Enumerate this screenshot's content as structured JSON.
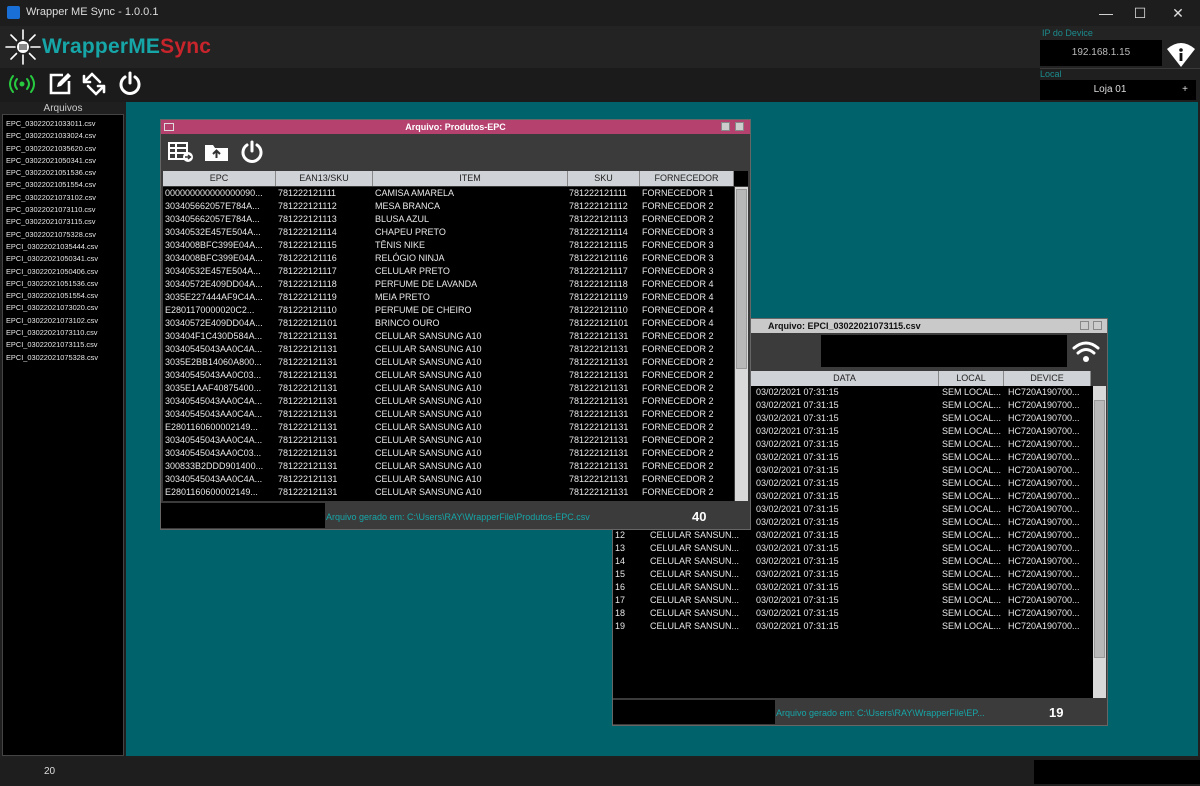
{
  "app": {
    "title": "Wrapper ME Sync - 1.0.0.1",
    "logo_wrapper": "WrapperME",
    "logo_sync": "Sync"
  },
  "window_controls": {
    "minimize": "—",
    "maximize": "☐",
    "close": "✕"
  },
  "toolbar": {
    "icons": [
      "rfid-signal-icon",
      "edit-icon",
      "sync-arrows-icon",
      "power-icon"
    ]
  },
  "device": {
    "ip_label": "IP do Device",
    "ip_value": "192.168.1.15",
    "local_label": "Local",
    "local_value": "Loja 01",
    "local_expand": "+"
  },
  "sidebar": {
    "title": "Arquivos",
    "files": [
      "EPC_03022021033011.csv",
      "EPC_03022021033024.csv",
      "EPC_03022021035620.csv",
      "EPC_03022021050341.csv",
      "EPC_03022021051536.csv",
      "EPC_03022021051554.csv",
      "EPC_03022021073102.csv",
      "EPC_03022021073110.csv",
      "EPC_03022021073115.csv",
      "EPC_03022021075328.csv",
      "EPCI_03022021035444.csv",
      "EPCI_03022021050341.csv",
      "EPCI_03022021050406.csv",
      "EPCI_03022021051536.csv",
      "EPCI_03022021051554.csv",
      "EPCI_03022021073020.csv",
      "EPCI_03022021073102.csv",
      "EPCI_03022021073110.csv",
      "EPCI_03022021073115.csv",
      "EPCI_03022021075328.csv"
    ]
  },
  "status": {
    "count": "20"
  },
  "products_window": {
    "title": "Arquivo: Produtos-EPC",
    "title_bg": "#b5416f",
    "columns": [
      "EPC",
      "EAN13/SKU",
      "ITEM",
      "SKU",
      "FORNECEDOR"
    ],
    "rows": [
      [
        "000000000000000090...",
        "781222121111",
        "CAMISA AMARELA",
        "781222121111",
        "FORNECEDOR 1"
      ],
      [
        "303405662057E784A...",
        "781222121112",
        "MESA BRANCA",
        "781222121112",
        "FORNECEDOR 2"
      ],
      [
        "303405662057E784A...",
        "781222121113",
        "BLUSA AZUL",
        "781222121113",
        "FORNECEDOR 2"
      ],
      [
        "30340532E457E504A...",
        "781222121114",
        "CHAPEU PRETO",
        "781222121114",
        "FORNECEDOR 3"
      ],
      [
        "3034008BFC399E04A...",
        "781222121115",
        "TÊNIS NIKE",
        "781222121115",
        "FORNECEDOR 3"
      ],
      [
        "3034008BFC399E04A...",
        "781222121116",
        "RELÓGIO NINJA",
        "781222121116",
        "FORNECEDOR 3"
      ],
      [
        "30340532E457E504A...",
        "781222121117",
        "CELULAR PRETO",
        "781222121117",
        "FORNECEDOR 3"
      ],
      [
        "30340572E409DD04A...",
        "781222121118",
        "PERFUME DE LAVANDA",
        "781222121118",
        "FORNECEDOR 4"
      ],
      [
        "3035E227444AF9C4A...",
        "781222121119",
        "MEIA PRETO",
        "781222121119",
        "FORNECEDOR 4"
      ],
      [
        "E2801170000020C2...",
        "781222121110",
        "PERFUME DE CHEIRO",
        "781222121110",
        "FORNECEDOR 4"
      ],
      [
        "30340572E409DD04A...",
        "781222121101",
        "BRINCO OURO",
        "781222121101",
        "FORNECEDOR 4"
      ],
      [
        "303404F1C430D584A...",
        "781222121131",
        "CELULAR SANSUNG A10",
        "781222121131",
        "FORNECEDOR 2"
      ],
      [
        "30340545043AA0C4A...",
        "781222121131",
        "CELULAR SANSUNG A10",
        "781222121131",
        "FORNECEDOR 2"
      ],
      [
        "3035E2BB14060A800...",
        "781222121131",
        "CELULAR SANSUNG A10",
        "781222121131",
        "FORNECEDOR 2"
      ],
      [
        "30340545043AA0C03...",
        "781222121131",
        "CELULAR SANSUNG A10",
        "781222121131",
        "FORNECEDOR 2"
      ],
      [
        "3035E1AAF40875400...",
        "781222121131",
        "CELULAR SANSUNG A10",
        "781222121131",
        "FORNECEDOR 2"
      ],
      [
        "30340545043AA0C4A...",
        "781222121131",
        "CELULAR SANSUNG A10",
        "781222121131",
        "FORNECEDOR 2"
      ],
      [
        "30340545043AA0C4A...",
        "781222121131",
        "CELULAR SANSUNG A10",
        "781222121131",
        "FORNECEDOR 2"
      ],
      [
        "E2801160600002149...",
        "781222121131",
        "CELULAR SANSUNG A10",
        "781222121131",
        "FORNECEDOR 2"
      ],
      [
        "30340545043AA0C4A...",
        "781222121131",
        "CELULAR SANSUNG A10",
        "781222121131",
        "FORNECEDOR 2"
      ],
      [
        "30340545043AA0C03...",
        "781222121131",
        "CELULAR SANSUNG A10",
        "781222121131",
        "FORNECEDOR 2"
      ],
      [
        "300833B2DDD901400...",
        "781222121131",
        "CELULAR SANSUNG A10",
        "781222121131",
        "FORNECEDOR 2"
      ],
      [
        "30340545043AA0C4A...",
        "781222121131",
        "CELULAR SANSUNG A10",
        "781222121131",
        "FORNECEDOR 2"
      ],
      [
        "E2801160600002149...",
        "781222121131",
        "CELULAR SANSUNG A10",
        "781222121131",
        "FORNECEDOR 2"
      ]
    ],
    "footer_path": "Arquivo gerado em: C:\\Users\\RAY\\WrapperFile\\Produtos-EPC.csv",
    "footer_count": "40"
  },
  "epci_window": {
    "title": "Arquivo: EPCI_03022021073115.csv",
    "columns": [
      "DATA",
      "LOCAL",
      "DEVICE"
    ],
    "rows_top": [
      [
        "03/02/2021 07:31:15",
        "SEM LOCAL...",
        "HC720A190700..."
      ],
      [
        "03/02/2021 07:31:15",
        "SEM LOCAL...",
        "HC720A190700..."
      ],
      [
        "03/02/2021 07:31:15",
        "SEM LOCAL...",
        "HC720A190700..."
      ],
      [
        "03/02/2021 07:31:15",
        "SEM LOCAL...",
        "HC720A190700..."
      ],
      [
        "03/02/2021 07:31:15",
        "SEM LOCAL...",
        "HC720A190700..."
      ],
      [
        "03/02/2021 07:31:15",
        "SEM LOCAL...",
        "HC720A190700..."
      ],
      [
        "03/02/2021 07:31:15",
        "SEM LOCAL...",
        "HC720A190700..."
      ],
      [
        "03/02/2021 07:31:15",
        "SEM LOCAL...",
        "HC720A190700..."
      ],
      [
        "03/02/2021 07:31:15",
        "SEM LOCAL...",
        "HC720A190700..."
      ],
      [
        "03/02/2021 07:31:15",
        "SEM LOCAL...",
        "HC720A190700..."
      ],
      [
        "03/02/2021 07:31:15",
        "SEM LOCAL...",
        "HC720A190700..."
      ]
    ],
    "rows_bottom": [
      [
        "12",
        "CELULAR SANSUN...",
        "03/02/2021 07:31:15",
        "SEM LOCAL...",
        "HC720A190700..."
      ],
      [
        "13",
        "CELULAR SANSUN...",
        "03/02/2021 07:31:15",
        "SEM LOCAL...",
        "HC720A190700..."
      ],
      [
        "14",
        "CELULAR SANSUN...",
        "03/02/2021 07:31:15",
        "SEM LOCAL...",
        "HC720A190700..."
      ],
      [
        "15",
        "CELULAR SANSUN...",
        "03/02/2021 07:31:15",
        "SEM LOCAL...",
        "HC720A190700..."
      ],
      [
        "16",
        "CELULAR SANSUN...",
        "03/02/2021 07:31:15",
        "SEM LOCAL...",
        "HC720A190700..."
      ],
      [
        "17",
        "CELULAR SANSUN...",
        "03/02/2021 07:31:15",
        "SEM LOCAL...",
        "HC720A190700..."
      ],
      [
        "18",
        "CELULAR SANSUN...",
        "03/02/2021 07:31:15",
        "SEM LOCAL...",
        "HC720A190700..."
      ],
      [
        "19",
        "CELULAR SANSUN...",
        "03/02/2021 07:31:15",
        "SEM LOCAL...",
        "HC720A190700..."
      ]
    ],
    "footer_path": "Arquivo gerado em: C:\\Users\\RAY\\WrapperFile\\EP...",
    "footer_count": "19"
  }
}
